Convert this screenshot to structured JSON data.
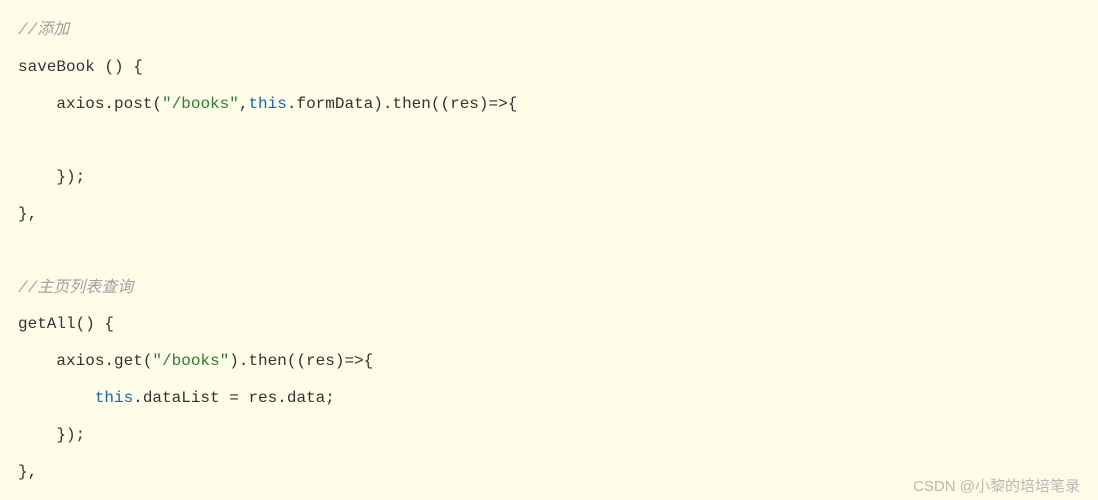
{
  "code": {
    "comment1": "//添加",
    "line2_a": "saveBook () {",
    "line3_a": "    axios.post(",
    "line3_str": "\"/books\"",
    "line3_b": ",",
    "line3_kw": "this",
    "line3_c": ".formData).then((res)=>{",
    "line5_a": "    });",
    "line6_a": "},",
    "comment2": "//主页列表查询",
    "line9_a": "getAll() {",
    "line10_a": "    axios.get(",
    "line10_str": "\"/books\"",
    "line10_b": ").then((res)=>{",
    "line11_a": "        ",
    "line11_kw": "this",
    "line11_b": ".dataList = res.data;",
    "line12_a": "    });",
    "line13_a": "},"
  },
  "watermark": "CSDN @小黎的培培笔录"
}
